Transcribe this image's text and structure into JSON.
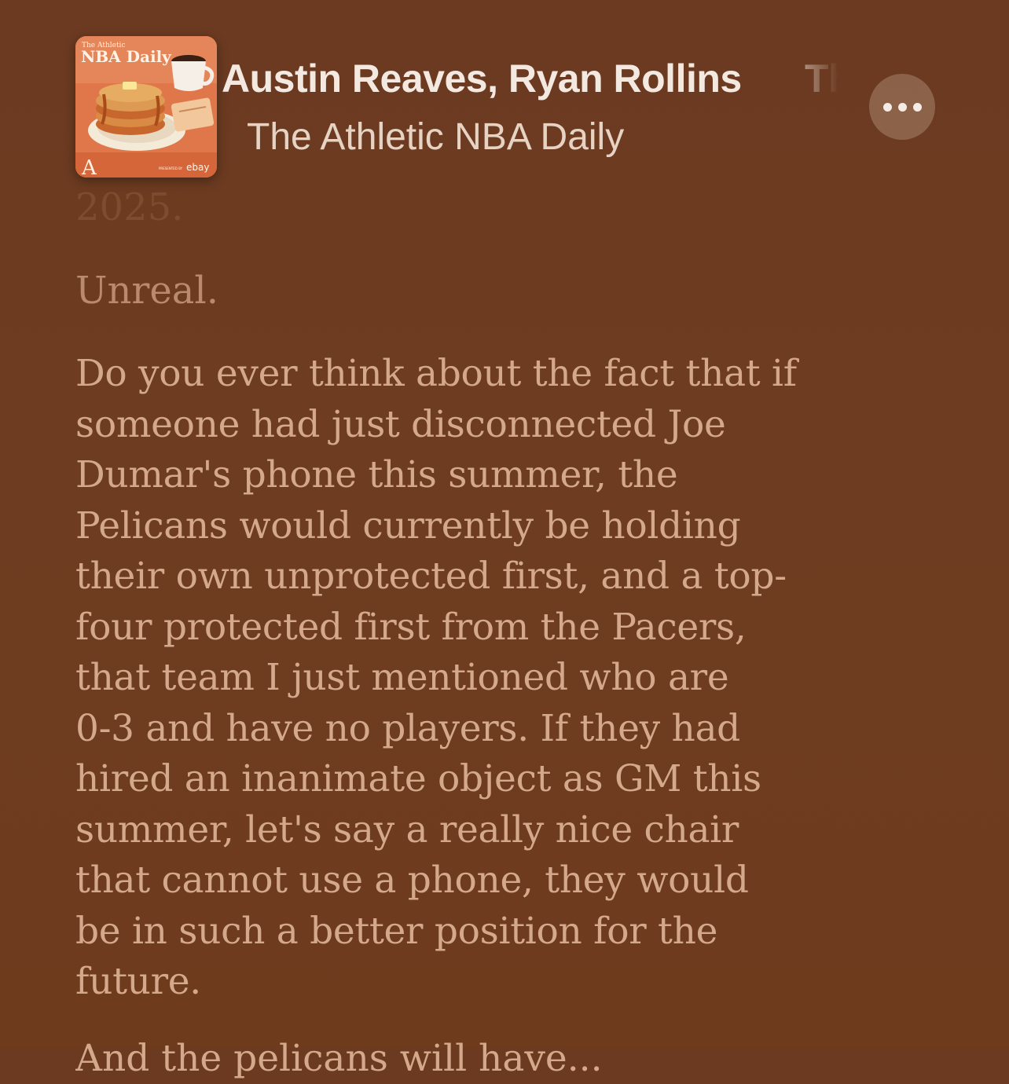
{
  "header": {
    "artwork": {
      "kicker": "The Athletic",
      "name": "NBA Daily",
      "sponsor_prefix": "PRESENTED BY",
      "sponsor": "ebay",
      "logo_letter": "A"
    },
    "episode_title": "Austin Reaves, Ryan Rollins      The",
    "show_name": "The Athletic NBA Daily",
    "more_icon": "ellipsis-icon"
  },
  "transcript": {
    "year": "2025.",
    "short_line": "Unreal.",
    "paragraph_lines": [
      "Do you ever think about the fact that if",
      "someone had just disconnected Joe",
      "Dumar's phone this summer, the",
      "Pelicans would currently be holding",
      "their own unprotected first, and a top-",
      "four protected first from the Pacers,",
      "that team I just mentioned who are",
      "0-3 and have no players. If they had",
      "hired an inanimate object as GM this",
      "summer, let's say a really nice chair",
      "that cannot use a phone, they would",
      "be in such a better position for the",
      "future."
    ],
    "cutoff_line": "And the pelicans will have..."
  },
  "colors": {
    "background": "#6e3c20",
    "lyric_text": "#d4a98b",
    "title_text": "#f3e9e1"
  }
}
